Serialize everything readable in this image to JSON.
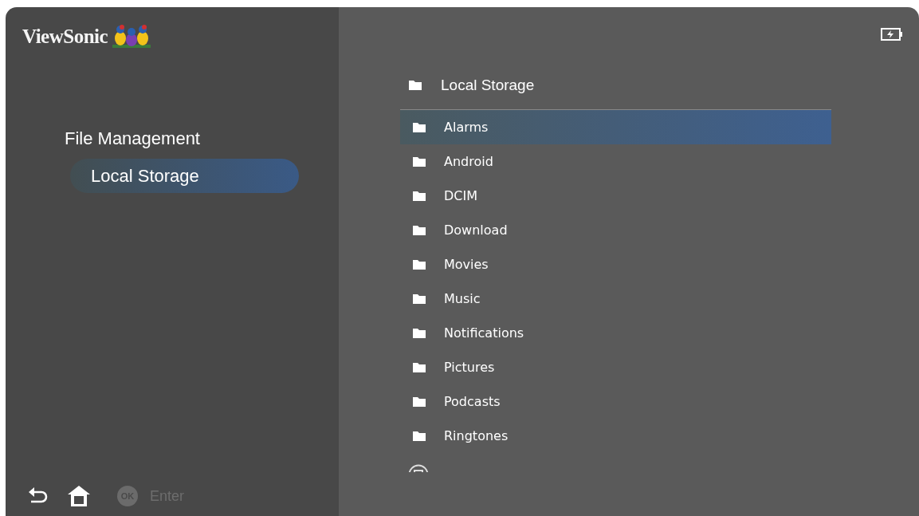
{
  "brand": {
    "name": "ViewSonic"
  },
  "sidebar": {
    "title": "File Management",
    "items": [
      {
        "label": "Local Storage",
        "selected": true
      }
    ]
  },
  "footer": {
    "ok_key": "OK",
    "hint": "Enter"
  },
  "browser": {
    "path": "Local Storage",
    "entries": [
      {
        "name": "Alarms",
        "kind": "folder",
        "selected": true
      },
      {
        "name": "Android",
        "kind": "folder",
        "selected": false
      },
      {
        "name": "DCIM",
        "kind": "folder",
        "selected": false
      },
      {
        "name": "Download",
        "kind": "folder",
        "selected": false
      },
      {
        "name": "Movies",
        "kind": "folder",
        "selected": false
      },
      {
        "name": "Music",
        "kind": "folder",
        "selected": false
      },
      {
        "name": "Notifications",
        "kind": "folder",
        "selected": false
      },
      {
        "name": "Pictures",
        "kind": "folder",
        "selected": false
      },
      {
        "name": "Podcasts",
        "kind": "folder",
        "selected": false
      },
      {
        "name": "Ringtones",
        "kind": "folder",
        "selected": false
      },
      {
        "kind": "file",
        "selected": false
      }
    ]
  }
}
